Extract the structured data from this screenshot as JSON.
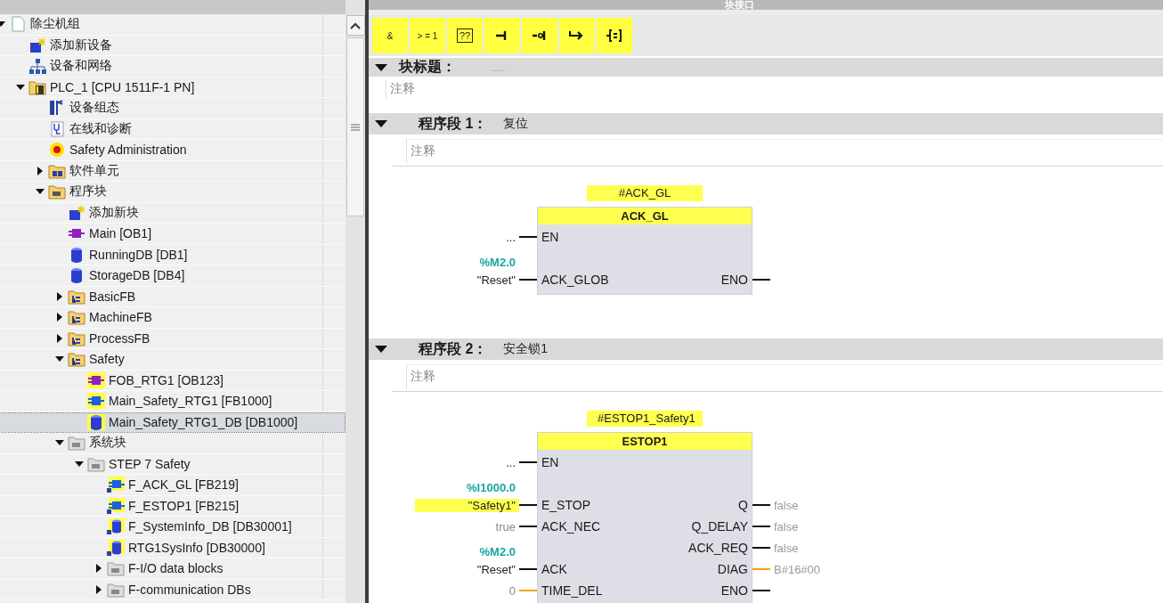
{
  "tree": {
    "items": [
      {
        "label": "除尘机组",
        "kind": "project",
        "expanded": true,
        "selected": false,
        "children": [
          {
            "label": "添加新设备",
            "kind": "add",
            "selected": false
          },
          {
            "label": "设备和网络",
            "kind": "network",
            "selected": false
          },
          {
            "label": "PLC_1 [CPU 1511F-1 PN]",
            "kind": "plc",
            "expanded": true,
            "selected": false,
            "children": [
              {
                "label": "设备组态",
                "kind": "config",
                "selected": false
              },
              {
                "label": "在线和诊断",
                "kind": "diag",
                "selected": false
              },
              {
                "label": "Safety Administration",
                "kind": "safety",
                "selected": false
              },
              {
                "label": "软件单元",
                "kind": "folder-units",
                "expanded": false,
                "selected": false
              },
              {
                "label": "程序块",
                "kind": "folder-blocks",
                "expanded": true,
                "selected": false,
                "children": [
                  {
                    "label": "添加新块",
                    "kind": "add",
                    "selected": false
                  },
                  {
                    "label": "Main [OB1]",
                    "kind": "ob",
                    "selected": false
                  },
                  {
                    "label": "RunningDB [DB1]",
                    "kind": "db",
                    "selected": false
                  },
                  {
                    "label": "StorageDB [DB4]",
                    "kind": "db",
                    "selected": false
                  },
                  {
                    "label": "BasicFB",
                    "kind": "folder-group",
                    "expanded": false,
                    "selected": false
                  },
                  {
                    "label": "MachineFB",
                    "kind": "folder-group",
                    "expanded": false,
                    "selected": false
                  },
                  {
                    "label": "ProcessFB",
                    "kind": "folder-group",
                    "expanded": false,
                    "selected": false
                  },
                  {
                    "label": "Safety",
                    "kind": "folder-group",
                    "expanded": true,
                    "selected": false,
                    "children": [
                      {
                        "label": "FOB_RTG1 [OB123]",
                        "kind": "f-ob",
                        "selected": false
                      },
                      {
                        "label": "Main_Safety_RTG1 [FB1000]",
                        "kind": "f-fb",
                        "selected": false
                      },
                      {
                        "label": "Main_Safety_RTG1_DB [DB1000]",
                        "kind": "f-db",
                        "selected": true
                      }
                    ]
                  },
                  {
                    "label": "系统块",
                    "kind": "folder-system",
                    "expanded": true,
                    "selected": false,
                    "children": [
                      {
                        "label": "STEP 7 Safety",
                        "kind": "folder-system",
                        "expanded": true,
                        "selected": false,
                        "children": [
                          {
                            "label": "F_ACK_GL [FB219]",
                            "kind": "lib-fb",
                            "selected": false
                          },
                          {
                            "label": "F_ESTOP1 [FB215]",
                            "kind": "lib-fb",
                            "selected": false
                          },
                          {
                            "label": "F_SystemInfo_DB [DB30001]",
                            "kind": "lib-db",
                            "selected": false
                          },
                          {
                            "label": "RTG1SysInfo [DB30000]",
                            "kind": "lib-db",
                            "selected": false
                          },
                          {
                            "label": "F-I/O data blocks",
                            "kind": "folder-system",
                            "expanded": false,
                            "selected": false
                          },
                          {
                            "label": "F-communication DBs",
                            "kind": "folder-system",
                            "expanded": false,
                            "selected": false
                          }
                        ]
                      }
                    ]
                  }
                ]
              }
            ]
          }
        ]
      }
    ]
  },
  "editor": {
    "header": "块接口",
    "toolbar": [
      {
        "kind": "text",
        "label": "&"
      },
      {
        "kind": "text",
        "label": "> = 1"
      },
      {
        "kind": "box",
        "label": "??"
      },
      {
        "kind": "contact"
      },
      {
        "kind": "negated"
      },
      {
        "kind": "branch"
      },
      {
        "kind": "assign"
      }
    ],
    "block_title": {
      "label": "块标题：",
      "title": ".....",
      "comment": "注释"
    },
    "networks": [
      {
        "label": "程序段 1：",
        "title": "复位",
        "comment": "注释",
        "block": {
          "instance": "#ACK_GL",
          "type": "ACK_GL",
          "inputs": [
            {
              "kind": "pin",
              "pin": "EN",
              "operand": "..."
            },
            {
              "kind": "address",
              "text": "%M2.0"
            },
            {
              "kind": "pin",
              "pin": "ACK_GLOB",
              "operand": "\"Reset\""
            }
          ],
          "outputs": [
            {
              "kind": "blank"
            },
            {
              "kind": "blank"
            },
            {
              "kind": "pin",
              "pin": "ENO"
            }
          ]
        }
      },
      {
        "label": "程序段 2：",
        "title": "安全锁1",
        "comment": "注释",
        "block": {
          "instance": "#ESTOP1_Safety1",
          "type": "ESTOP1",
          "inputs": [
            {
              "kind": "pin",
              "pin": "EN",
              "operand": "..."
            },
            {
              "kind": "address",
              "text": "%I1000.0"
            },
            {
              "kind": "pin",
              "pin": "E_STOP",
              "operand": "\"Safety1\"",
              "highlighted": true
            },
            {
              "kind": "constant",
              "pin": "ACK_NEC",
              "operand": "true"
            },
            {
              "kind": "address",
              "text": "%M2.0"
            },
            {
              "kind": "pin",
              "pin": "ACK",
              "operand": "\"Reset\""
            },
            {
              "kind": "constant-data",
              "pin": "TIME_DEL",
              "operand": "0"
            }
          ],
          "outputs": [
            {
              "kind": "blank"
            },
            {
              "kind": "blank"
            },
            {
              "kind": "pin",
              "pin": "Q",
              "value": "false"
            },
            {
              "kind": "pin",
              "pin": "Q_DELAY",
              "value": "false"
            },
            {
              "kind": "pin",
              "pin": "ACK_REQ",
              "value": "false"
            },
            {
              "kind": "data",
              "pin": "DIAG",
              "value": "B#16#00"
            },
            {
              "kind": "pin",
              "pin": "ENO"
            }
          ]
        }
      }
    ]
  }
}
